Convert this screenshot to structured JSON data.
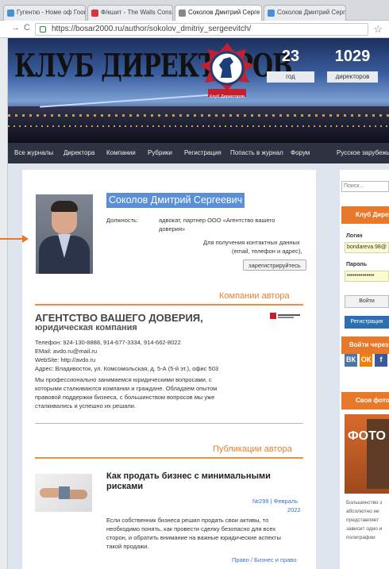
{
  "browser": {
    "tabs": [
      {
        "label": "Гугентю - Номе оф Гоогле",
        "color": "#4a90d9"
      },
      {
        "label": "Ф/кшит - The Walls Consul",
        "color": "#d9343a"
      },
      {
        "label": "Соколов Дмитрий Серге ",
        "color": "#888888"
      },
      {
        "label": "Соколов Дмитрий Сергеевич",
        "color": "#4a90d9"
      }
    ],
    "url": "https://bosar2000.ru/author/sokolov_dmitriy_sergeevitch/"
  },
  "header": {
    "logo": "КЛУБ ДИРЕКТОРОВ",
    "emblem_caption": "Клуб Директоров",
    "stats": [
      {
        "value": "23",
        "label": "год"
      },
      {
        "value": "1029",
        "label": "директоров"
      }
    ]
  },
  "nav": {
    "items": [
      "Все журналы",
      "Директора",
      "Компании",
      "Рубрики",
      "Регистрация",
      "Попасть в журнал",
      "Форум",
      "Русское зарубежье"
    ]
  },
  "profile": {
    "name": "Соколов Дмитрий Сергеевич",
    "position_label": "Должность:",
    "position_value_1": "адвокат, партнер ООО «Агентство вашего",
    "position_value_2": "доверия»",
    "contact_note_1": "Для получения контактных данных",
    "contact_note_2": "(email, телефон и адрес),",
    "register_button": "зарегистрируйтесь"
  },
  "company": {
    "section_title": "Компании автора",
    "name": "АГЕНТСТВО ВАШЕГО ДОВЕРИЯ,",
    "subtitle": "юридическая компания",
    "phone": "Телефон: 924-130-8888, 914-677-3334, 914-662-8022",
    "email": "EMail: avdo.ru@mail.ru",
    "website": "WebSite: http://avdo.ru",
    "address": "Адрес: Владивосток, ул. Комсомольская, д. 5-А (5-й эт.), офис 503",
    "desc_1": "Мы профессионально занимаемся юридическими вопросами, с",
    "desc_2": "которыми сталкиваются компании и граждане. Обладаем опытом",
    "desc_3": "правовой поддержки бизнеса, с большинством вопросов мы уже",
    "desc_4": "сталкивались и успешно их решали."
  },
  "publications": {
    "section_title": "Публикации автора",
    "items": [
      {
        "title_1": "Как продать бизнес с минимальными",
        "title_2": "рисками",
        "issue": "№299 | Февраль",
        "year": "2022",
        "text_1": "Если собственник бизнеса решил продать свои активы, то",
        "text_2": "необходимо понять, как провести сделку безопасно для всех",
        "text_3": "сторон, и обратить внимание на важные юридические аспекты",
        "text_4": "такой продажи.",
        "tags": "Право / Бизнес и право"
      }
    ]
  },
  "sidebar": {
    "search_placeholder": "Поиск...",
    "club_title": "Клуб Директоров",
    "login_label": "Логин",
    "login_value": "bondareva.98@",
    "password_label": "Пароль",
    "password_value": "••••••••••••••",
    "login_button": "Войти",
    "register_button": "Регистрация",
    "social_title": "Войти через",
    "social": [
      {
        "name": "vk",
        "label": "ВК",
        "color": "#4c75a3"
      },
      {
        "name": "ok",
        "label": "ОК",
        "color": "#ee8208"
      },
      {
        "name": "fb",
        "label": "f",
        "color": "#3b5998"
      }
    ],
    "photo_title": "Своя фотостудия",
    "photo_word": "ФОТО",
    "photo_text_1": "Большинство з",
    "photo_text_2": "абсолютно не",
    "photo_text_3": "представляет",
    "photo_text_4": "зависит одно и",
    "photo_text_5": "полиграфии"
  }
}
